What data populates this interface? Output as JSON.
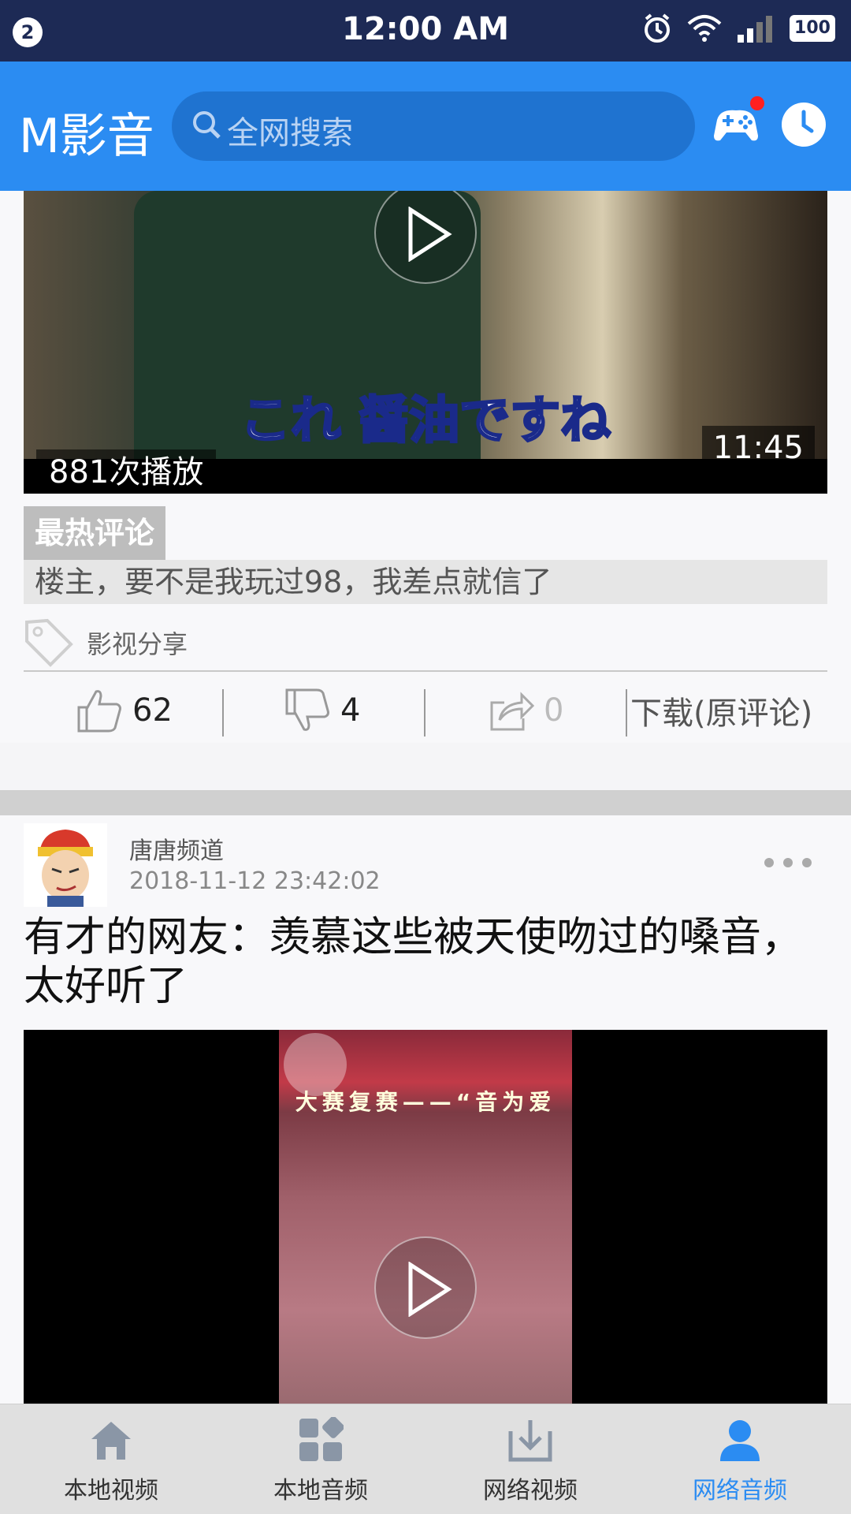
{
  "status_bar": {
    "notification_count": "2",
    "time": "12:00 AM",
    "battery": "100"
  },
  "header": {
    "app_title": "M影音",
    "search_placeholder": "全网搜索",
    "icons": [
      "search-icon",
      "gamepad-icon",
      "clock-icon"
    ]
  },
  "feed": {
    "card1": {
      "views": "881次播放",
      "duration": "11:45",
      "subtitle_overlay": "これ 醤油ですね",
      "hot_comment_label": "最热评论",
      "hot_comment": "楼主，要不是我玩过98，我差点就信了",
      "tag": "影视分享",
      "likes": "62",
      "dislikes": "4",
      "shares": "0",
      "download_label": "下载(原评论)"
    },
    "card2": {
      "channel": "唐唐频道",
      "posted_at": "2018-11-12 23:42:02",
      "title": "有才的网友：羡慕这些被天使吻过的嗓音，太好听了",
      "banner_text": "大赛复赛——“音为爱"
    }
  },
  "bottom_nav": {
    "items": [
      {
        "label": "本地视频",
        "icon": "home-icon",
        "active": false
      },
      {
        "label": "本地音频",
        "icon": "apps-icon",
        "active": false
      },
      {
        "label": "网络视频",
        "icon": "download-icon",
        "active": false
      },
      {
        "label": "网络音频",
        "icon": "user-icon",
        "active": true
      }
    ]
  },
  "colors": {
    "accent": "#2b8cf2",
    "status_bar": "#1d2a55",
    "nav_background": "#e0e0e0"
  }
}
